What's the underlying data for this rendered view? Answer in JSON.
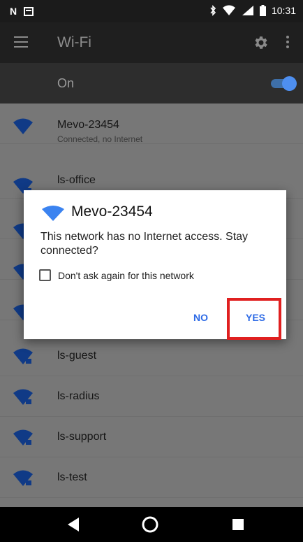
{
  "status_bar": {
    "left_icons": [
      "N",
      "notification-icon"
    ],
    "right_icons": [
      "bluetooth-icon",
      "wifi-icon",
      "lte-signal-icon",
      "battery-icon"
    ],
    "time": "10:31"
  },
  "toolbar": {
    "title": "Wi-Fi",
    "icons": [
      "menu-icon",
      "gear-icon",
      "more-vert-icon"
    ]
  },
  "wifi_switch": {
    "label": "On",
    "state": true,
    "accent_color": "#4e8ff0"
  },
  "networks": [
    {
      "name": "Mevo-23454",
      "status": "Connected, no Internet",
      "secured": false
    },
    {
      "name": "ls-office",
      "status": "",
      "secured": true
    },
    {
      "name": "",
      "status": "",
      "secured": true
    },
    {
      "name": "",
      "status": "",
      "secured": true
    },
    {
      "name": "",
      "status": "",
      "secured": true
    },
    {
      "name": "ls-guest",
      "status": "",
      "secured": true
    },
    {
      "name": "ls-radius",
      "status": "",
      "secured": true
    },
    {
      "name": "ls-support",
      "status": "",
      "secured": true
    },
    {
      "name": "ls-test",
      "status": "",
      "secured": true
    }
  ],
  "dialog": {
    "title": "Mevo-23454",
    "message": "This network has no Internet access. Stay connected?",
    "checkbox_label": "Don't ask again for this network",
    "checkbox_checked": false,
    "no_label": "NO",
    "yes_label": "YES",
    "button_color": "#2e6be6",
    "highlight_color": "#e02020"
  },
  "nav_bar": {
    "icons": [
      "back-icon",
      "home-icon",
      "recents-icon"
    ]
  }
}
